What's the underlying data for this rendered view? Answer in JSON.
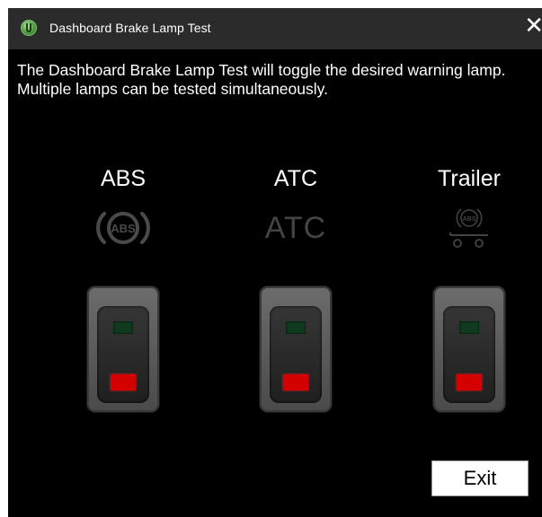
{
  "window": {
    "title": "Dashboard Brake Lamp Test",
    "close_label": "✕"
  },
  "description": "The Dashboard Brake Lamp Test will toggle the desired warning lamp. Multiple lamps can be tested simultaneously.",
  "lamps": [
    {
      "label": "ABS",
      "icon": "abs-lamp-icon",
      "icon_text": "ABS",
      "state": "off"
    },
    {
      "label": "ATC",
      "icon": "atc-lamp-icon",
      "icon_text": "ATC",
      "state": "off"
    },
    {
      "label": "Trailer",
      "icon": "trailer-abs-lamp-icon",
      "icon_text": "ABS",
      "state": "off"
    }
  ],
  "colors": {
    "background": "#000000",
    "titlebar": "#2b2b2b",
    "icon_dim": "#444444",
    "led_green_off": "#0f3a1e",
    "led_red": "#d40000"
  },
  "exit_label": "Exit"
}
